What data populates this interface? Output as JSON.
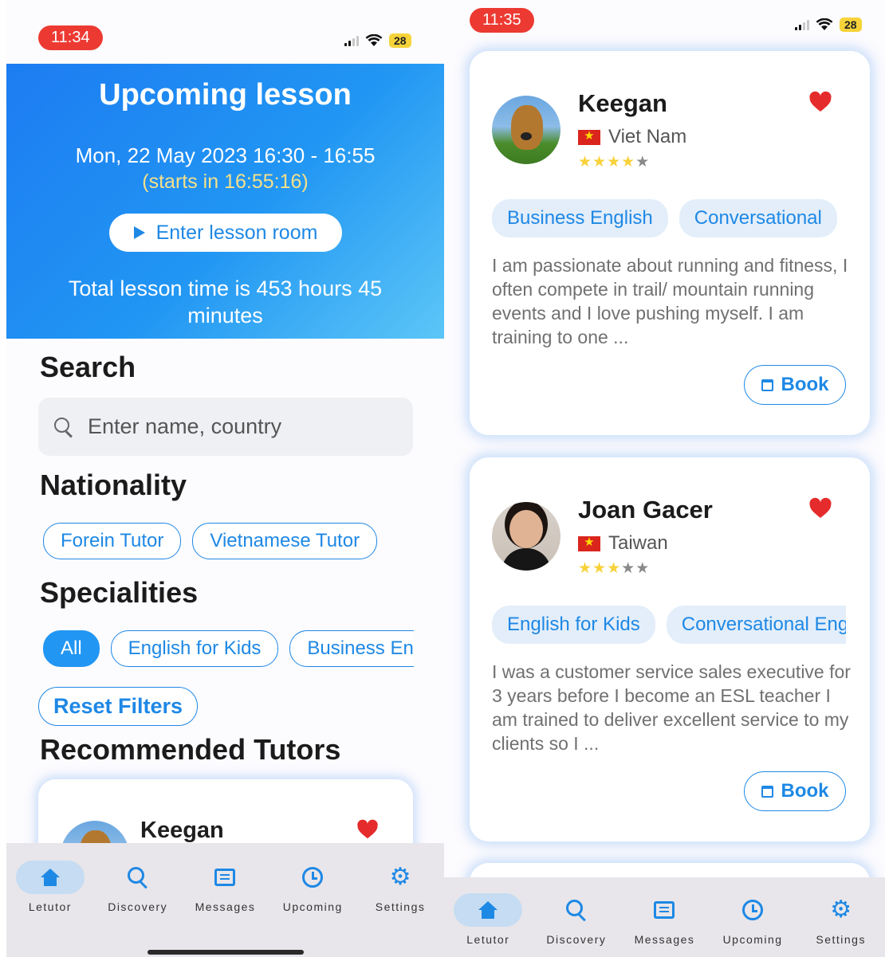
{
  "left_screen": {
    "status": {
      "time": "11:34",
      "battery": "28"
    },
    "upcoming": {
      "title": "Upcoming lesson",
      "date": "Mon, 22 May 2023 16:30 - 16:55",
      "countdown": "(starts in 16:55:16)",
      "enter_button": "Enter lesson room",
      "total_time": "Total lesson time is 453 hours 45 minutes"
    },
    "search": {
      "heading": "Search",
      "placeholder": "Enter name, country"
    },
    "nationality": {
      "heading": "Nationality",
      "chips": [
        "Forein Tutor",
        "Vietnamese Tutor"
      ]
    },
    "specialities": {
      "heading": "Specialities",
      "chips": [
        "All",
        "English for Kids",
        "Business English"
      ],
      "active": "All"
    },
    "reset_button": "Reset Filters",
    "recommended": {
      "heading": "Recommended Tutors",
      "first_tutor_name": "Keegan"
    }
  },
  "right_screen": {
    "status": {
      "time": "11:35",
      "battery": "28"
    },
    "tutors": [
      {
        "name": "Keegan",
        "country": "Viet Nam",
        "rating": 4,
        "specialities": [
          "Business English",
          "Conversational"
        ],
        "bio": "I am passionate about running and fitness, I often compete in trail/ mountain running events and I love pushing myself. I am training to one ...",
        "book_label": "Book",
        "favorited": true
      },
      {
        "name": "Joan Gacer",
        "country": "Taiwan",
        "rating": 3,
        "specialities": [
          "English for Kids",
          "Conversational English"
        ],
        "bio": "I was a customer service sales executive for 3 years before I become an ESL teacher I am trained to deliver excellent service to my clients so I ...",
        "book_label": "Book",
        "favorited": true
      }
    ]
  },
  "nav": {
    "items": [
      {
        "label": "Letutor",
        "icon": "home-icon"
      },
      {
        "label": "Discovery",
        "icon": "search-icon"
      },
      {
        "label": "Messages",
        "icon": "message-icon"
      },
      {
        "label": "Upcoming",
        "icon": "clock-icon"
      },
      {
        "label": "Settings",
        "icon": "gear-icon"
      }
    ],
    "active": "Letutor"
  },
  "colors": {
    "primary": "#1e88e5",
    "banner_start": "#1d7cf2",
    "banner_end": "#5cc6f7",
    "countdown": "#f5e08a",
    "heart": "#e52b2b",
    "star": "#f7d23a"
  }
}
